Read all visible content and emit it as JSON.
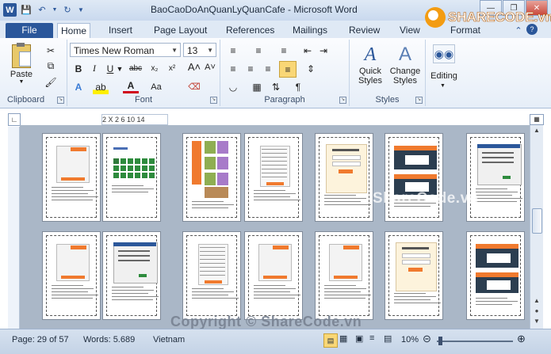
{
  "window": {
    "title": "BaoCaoDoAnQuanLyQuanCafe - Microsoft Word",
    "app_icon": "W",
    "controls": [
      "minimize-icon",
      "restore-icon",
      "close-icon"
    ]
  },
  "logo_overlay": {
    "text": "SHARECODE.vn"
  },
  "tabs": [
    {
      "label": "File"
    },
    {
      "label": "Home"
    },
    {
      "label": "Insert"
    },
    {
      "label": "Page Layout"
    },
    {
      "label": "References"
    },
    {
      "label": "Mailings"
    },
    {
      "label": "Review"
    },
    {
      "label": "View"
    },
    {
      "label": "Format"
    }
  ],
  "ribbon": {
    "clipboard": {
      "label": "Clipboard",
      "paste": "Paste"
    },
    "font": {
      "label": "Font",
      "font_name": "Times New Roman",
      "font_size": "13"
    },
    "paragraph": {
      "label": "Paragraph"
    },
    "styles": {
      "label": "Styles",
      "quick_styles": "Quick Styles",
      "change_styles": "Change Styles"
    },
    "editing": {
      "label": "Editing"
    }
  },
  "ruler": {
    "text": "2 X 2   6   10  14"
  },
  "thumbnails_row1": [
    "form",
    "grid",
    "menu",
    "table",
    "login",
    "dark",
    "dialog"
  ],
  "thumbnails_row2": [
    "form",
    "dialog",
    "table",
    "form",
    "form",
    "login",
    "dark"
  ],
  "watermarks": {
    "center": "ShareCode.vn",
    "bottom": "Copyright © ShareCode.vn"
  },
  "statusbar": {
    "page": "Page: 29 of 57",
    "words": "Words: 5.689",
    "language": "Vietnam",
    "zoom": "10%"
  },
  "colors": {
    "accent": "#2b579a",
    "orange": "#f07a2e",
    "green": "#2e8b3d"
  }
}
